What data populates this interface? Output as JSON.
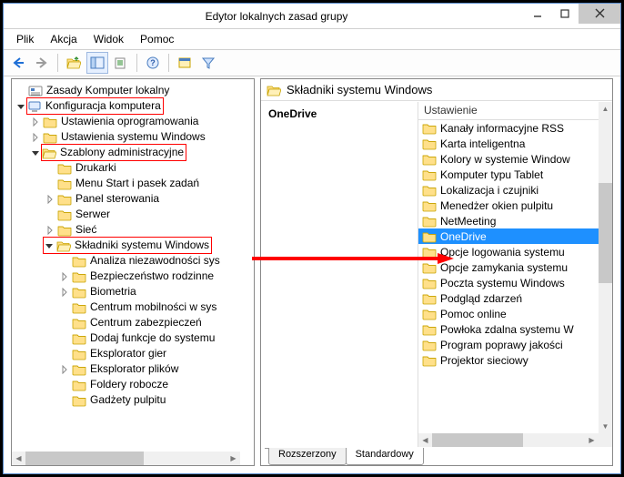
{
  "window": {
    "title": "Edytor lokalnych zasad grupy"
  },
  "menu": {
    "file": "Plik",
    "action": "Akcja",
    "view": "Widok",
    "help": "Pomoc"
  },
  "tree": {
    "root": "Zasady Komputer lokalny",
    "computer_config": "Konfiguracja komputera",
    "software_settings": "Ustawienia oprogramowania",
    "windows_settings": "Ustawienia systemu Windows",
    "admin_templates": "Szablony administracyjne",
    "printers": "Drukarki",
    "menu_start": "Menu Start i pasek zadań",
    "control_panel": "Panel sterowania",
    "server": "Serwer",
    "network": "Sieć",
    "windows_components": "Składniki systemu Windows",
    "reliability_analysis": "Analiza niezawodności sys",
    "family_safety": "Bezpieczeństwo rodzinne",
    "biometrics": "Biometria",
    "mobility_center": "Centrum mobilności w sys",
    "security_center": "Centrum zabezpieczeń",
    "add_features": "Dodaj funkcje do systemu",
    "game_explorer": "Eksplorator gier",
    "file_explorer": "Eksplorator plików",
    "work_folders": "Foldery robocze",
    "desktop_gadgets": "Gadżety pulpitu"
  },
  "right": {
    "header": "Składniki systemu Windows",
    "selected_name": "OneDrive",
    "column": "Ustawienie",
    "items": [
      "Kanały informacyjne RSS",
      "Karta inteligentna",
      "Kolory w systemie Window",
      "Komputer typu Tablet",
      "Lokalizacja i czujniki",
      "Menedżer okien pulpitu",
      "NetMeeting",
      "OneDrive",
      "Opcje logowania systemu",
      "Opcje zamykania systemu",
      "Poczta systemu Windows",
      "Podgląd zdarzeń",
      "Pomoc online",
      "Powłoka zdalna systemu W",
      "Program poprawy jakości",
      "Projektor sieciowy"
    ],
    "selected_index": 7
  },
  "tabs": {
    "extended": "Rozszerzony",
    "standard": "Standardowy"
  }
}
